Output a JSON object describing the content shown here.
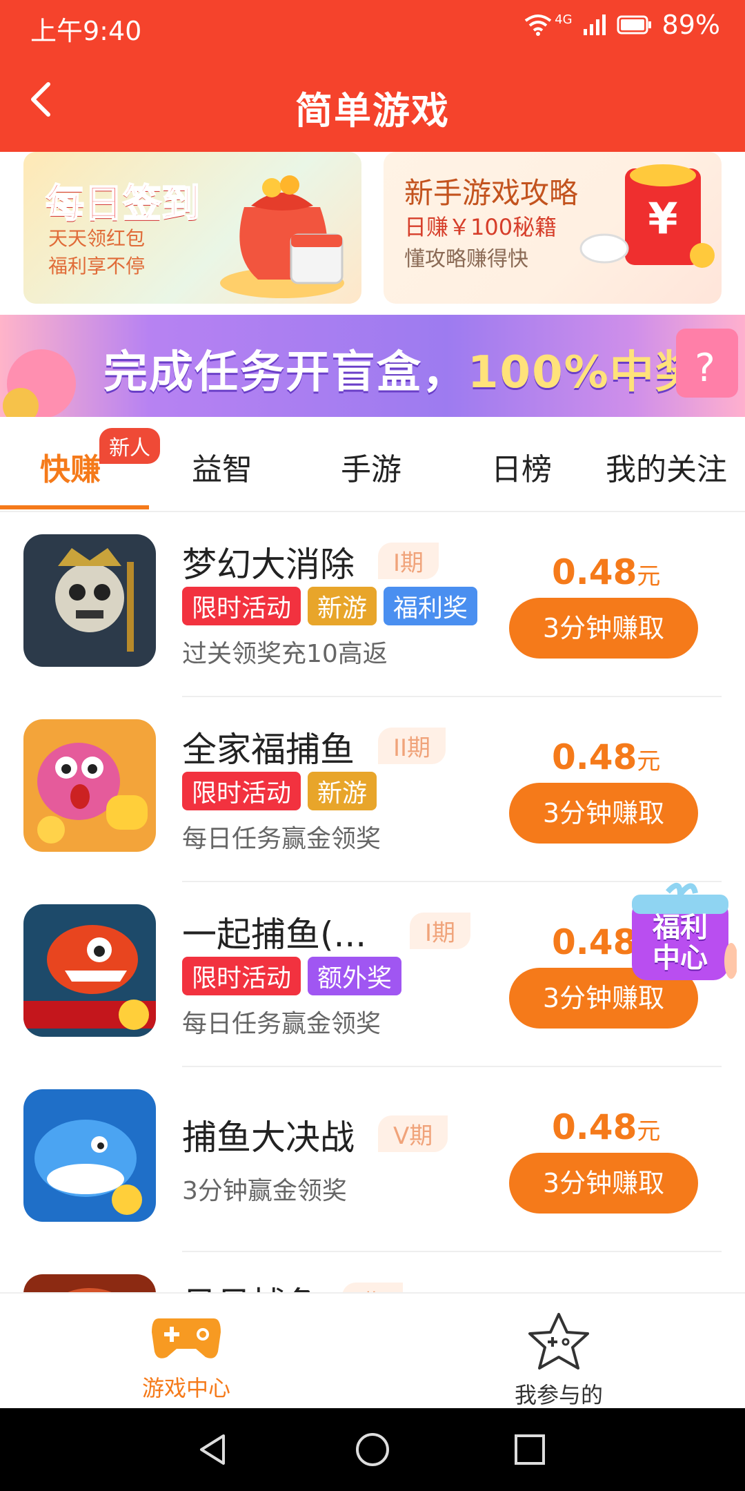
{
  "status_bar": {
    "time": "上午9:40",
    "network": "4G",
    "battery": "89%"
  },
  "header": {
    "title": "简单游戏"
  },
  "banners": {
    "checkin": {
      "title": "每日签到",
      "line1": "天天领红包",
      "line2": "福利享不停"
    },
    "guide": {
      "title": "新手游戏攻略",
      "line1": "日赚￥100秘籍",
      "line2": "懂攻略赚得快"
    }
  },
  "promo": {
    "text_main": "完成任务开盲盒，",
    "text_highlight": "100%中奖"
  },
  "tabs": [
    {
      "label": "快赚",
      "badge": "新人"
    },
    {
      "label": "益智"
    },
    {
      "label": "手游"
    },
    {
      "label": "日榜"
    },
    {
      "label": "我的关注"
    }
  ],
  "games": [
    {
      "name": "梦幻大消除",
      "period": "I期",
      "tags": [
        "限时活动",
        "新游",
        "福利奖"
      ],
      "desc": "过关领奖充10高返",
      "price": "0.48",
      "unit": "元",
      "button": "3分钟赚取"
    },
    {
      "name": "全家福捕鱼",
      "period": "II期",
      "tags": [
        "限时活动",
        "新游"
      ],
      "desc": "每日任务赢金领奖",
      "price": "0.48",
      "unit": "元",
      "button": "3分钟赚取"
    },
    {
      "name": "一起捕鱼(...",
      "period": "I期",
      "tags": [
        "限时活动",
        "额外奖"
      ],
      "desc": "每日任务赢金领奖",
      "price": "0.48",
      "unit": "元",
      "button": "3分钟赚取"
    },
    {
      "name": "捕鱼大决战",
      "period": "V期",
      "tags": [],
      "desc": "3分钟赢金领奖",
      "price": "0.48",
      "unit": "元",
      "button": "3分钟赚取"
    },
    {
      "name": "贝贝捕鱼",
      "period": "I期"
    }
  ],
  "float_widget": {
    "line1": "福利",
    "line2": "中心"
  },
  "bottom_nav": {
    "game_center": "游戏中心",
    "my_joined": "我参与的"
  },
  "colors": {
    "header_red": "#f5432c",
    "accent_orange": "#f57a1a"
  }
}
